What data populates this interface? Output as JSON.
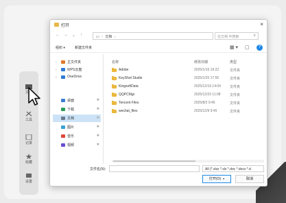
{
  "background_app": {
    "sidebar_buttons": [
      {
        "label": "文档",
        "icon": "folder-icon"
      },
      {
        "label": "工具",
        "icon": "tools-icon"
      },
      {
        "label": "记录",
        "icon": "notes-icon"
      },
      {
        "label": "收藏",
        "icon": "star-icon"
      },
      {
        "label": "设置",
        "icon": "gear-icon"
      }
    ]
  },
  "dialog": {
    "title": "打开",
    "close_glyph": "×",
    "nav": {
      "back": "←",
      "forward": "→",
      "up_history": "⌄",
      "up": "↑",
      "address_icon": "monitor-icon",
      "path": [
        "",
        "文档"
      ],
      "path_sep": "›",
      "address_chevron": "›",
      "refresh": "↻",
      "search_placeholder": "在文档 中搜索",
      "search_icon": "⌕"
    },
    "toolbar": {
      "organize": "组织 ▾",
      "new_folder": "新建文件夹",
      "view_icon": "▦ ▾",
      "pane_icon": "▢",
      "help": "?"
    },
    "sidebar": [
      {
        "label": "主文件夹",
        "icon": "home-icon",
        "color": "#e07a2a",
        "chevron": "›",
        "pin": ""
      },
      {
        "label": "WPS云盘",
        "icon": "cloud-icon",
        "color": "#2f7bd6",
        "chevron": "›",
        "pin": ""
      },
      {
        "label": "OneDrive",
        "icon": "onedrive-icon",
        "color": "#2f7bd6",
        "chevron": "›",
        "pin": ""
      },
      {
        "label": "桌面",
        "icon": "desktop-icon",
        "color": "#3b7fd0",
        "chevron": "",
        "pin": "✱"
      },
      {
        "label": "下载",
        "icon": "download-icon",
        "color": "#2c9b5a",
        "chevron": "",
        "pin": "✱"
      },
      {
        "label": "文档",
        "icon": "document-icon",
        "color": "#6b7b8c",
        "chevron": "",
        "pin": "✱",
        "selected": true
      },
      {
        "label": "图片",
        "icon": "pictures-icon",
        "color": "#3aa0d8",
        "chevron": "",
        "pin": "✱"
      },
      {
        "label": "音乐",
        "icon": "music-icon",
        "color": "#e0463a",
        "chevron": "",
        "pin": "✱"
      },
      {
        "label": "视频",
        "icon": "video-icon",
        "color": "#6a4ed0",
        "chevron": "",
        "pin": "✱"
      }
    ],
    "columns": {
      "name": "名称",
      "date": "修改日期",
      "type": "类型"
    },
    "files": [
      {
        "name": "Adobe",
        "date": "2025/1/16 19:22",
        "type": "文件夹"
      },
      {
        "name": "KeyShot Studio",
        "date": "2025/1/20 17:55",
        "type": "文件夹"
      },
      {
        "name": "KingsoftData",
        "date": "2025/12/19 14:04",
        "type": "文件夹"
      },
      {
        "name": "QQPCMgr",
        "date": "2025/12/23 11:08",
        "type": "文件夹"
      },
      {
        "name": "Tencent Files",
        "date": "2025/8/2 9:45",
        "type": "文件夹"
      },
      {
        "name": "wechat_files",
        "date": "2025/12/9 9:45",
        "type": "文件夹"
      }
    ],
    "bottom": {
      "filename_label": "文件名(N):",
      "filename_value": "",
      "filetype": "All (*.xlsx *.xls *.doc *.docx *.d",
      "filetype_caret": "▾",
      "open": "打开(O)",
      "open_caret": "▾",
      "cancel": "取消"
    }
  }
}
